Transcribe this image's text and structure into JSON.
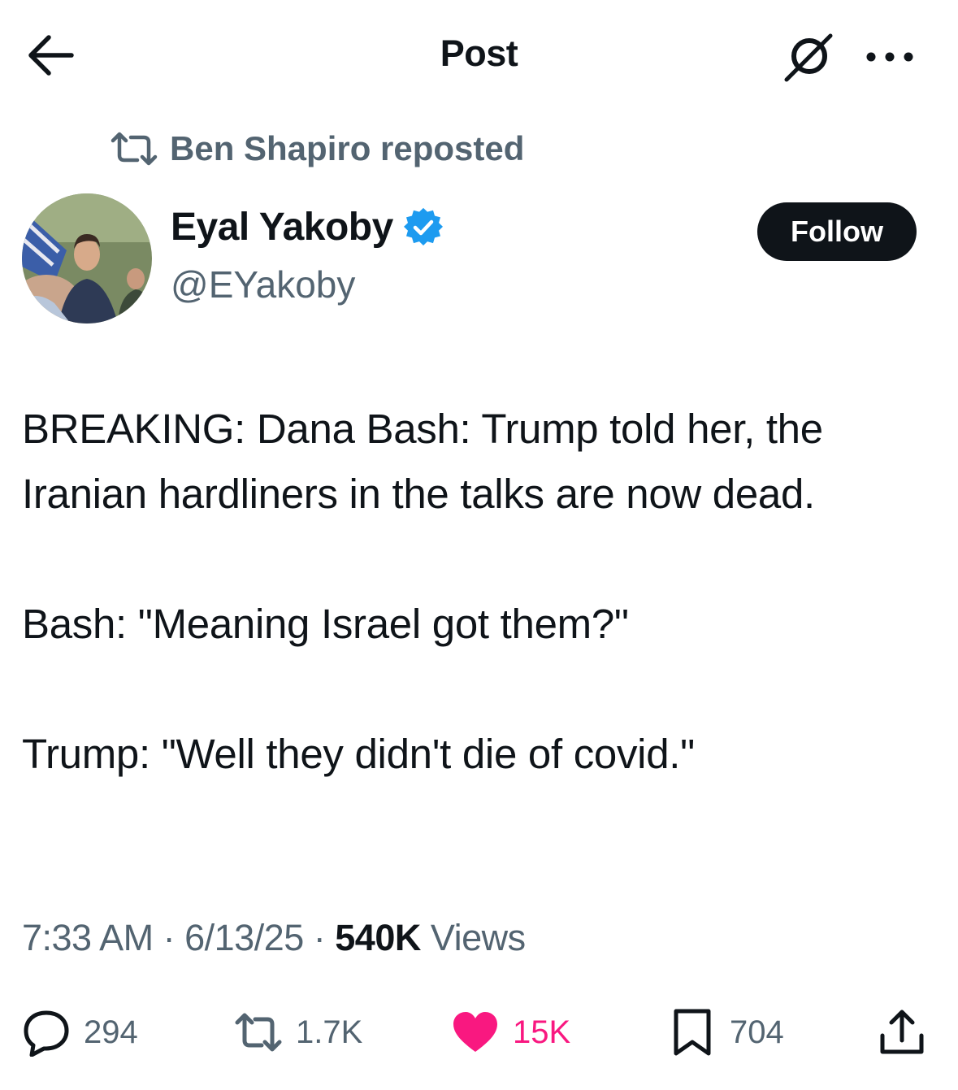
{
  "header": {
    "title": "Post",
    "back_icon": "arrow-left-icon",
    "grok_icon": "grok-icon",
    "more_icon": "more-horizontal-icon"
  },
  "repost": {
    "icon": "repost-icon",
    "text": "Ben Shapiro reposted"
  },
  "author": {
    "name": "Eyal Yakoby",
    "handle": "@EYakoby",
    "verified_icon": "verified-badge-icon",
    "verified_color": "#1d9bf0",
    "follow_label": "Follow"
  },
  "post": {
    "paragraphs": [
      "BREAKING: Dana Bash: Trump told her, the Iranian hardliners in the talks are now dead.",
      "Bash: \"Meaning Israel got them?\"",
      "Trump: \"Well they didn't die of covid.\""
    ],
    "time": "7:33 AM",
    "date": "6/13/25",
    "views_count": "540K",
    "views_label": "Views"
  },
  "actions": {
    "replies": "294",
    "reposts": "1.7K",
    "likes": "15K",
    "bookmarks": "704",
    "like_color": "#f91880",
    "icons": [
      "reply-icon",
      "repost-icon",
      "heart-icon",
      "bookmark-icon",
      "share-icon"
    ]
  }
}
